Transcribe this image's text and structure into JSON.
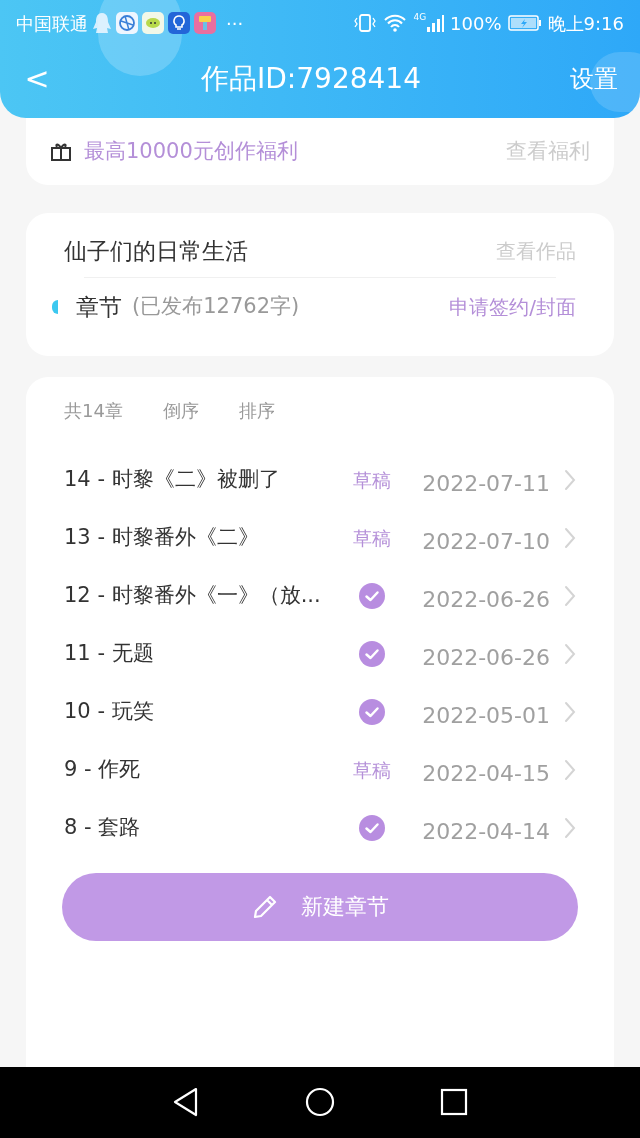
{
  "status_bar": {
    "carrier": "中国联通",
    "more": "···",
    "network": "4G",
    "battery": "100%",
    "time": "晚上9:16"
  },
  "header": {
    "back": "<",
    "title": "作品ID:7928414",
    "settings": "设置"
  },
  "benefit": {
    "text": "最高10000元创作福利",
    "link": "查看福利"
  },
  "work": {
    "title": "仙子们的日常生活",
    "link": "查看作品",
    "section": "章节",
    "word_count": "(已发布12762字)",
    "apply": "申请签约/封面"
  },
  "chapters": {
    "count": "共14章",
    "sort_actions": [
      "倒序",
      "排序"
    ],
    "items": [
      {
        "title": "14 - 时黎《二》被删了",
        "kind": "draft",
        "status": "草稿",
        "date": "2022-07-11"
      },
      {
        "title": "13 - 时黎番外《二》",
        "kind": "draft",
        "status": "草稿",
        "date": "2022-07-10"
      },
      {
        "title": "12 - 时黎番外《一》（放...",
        "kind": "published",
        "date": "2022-06-26"
      },
      {
        "title": "11 - 无题",
        "kind": "published",
        "date": "2022-06-26"
      },
      {
        "title": "10 - 玩笑",
        "kind": "published",
        "date": "2022-05-01"
      },
      {
        "title": "9 - 作死",
        "kind": "draft",
        "status": "草稿",
        "date": "2022-04-15"
      },
      {
        "title": "8 - 套路",
        "kind": "published",
        "date": "2022-04-14"
      }
    ],
    "new_button": "新建章节"
  }
}
